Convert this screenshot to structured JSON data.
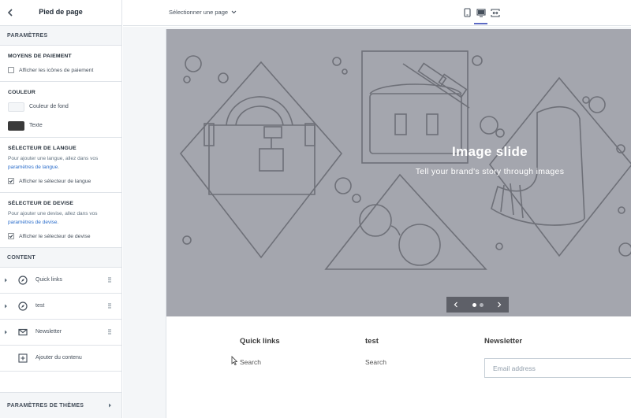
{
  "sidebar": {
    "title": "Pied de page",
    "settings_header": "PARAMÈTRES",
    "payment": {
      "title": "MOYENS DE PAIEMENT",
      "checkbox_label": "Afficher les icônes de paiement",
      "checked": false
    },
    "color": {
      "title": "COULEUR",
      "items": [
        {
          "label": "Couleur de fond",
          "swatch": "#f4f6f8"
        },
        {
          "label": "Texte",
          "swatch": "#3a3a3a"
        }
      ]
    },
    "language": {
      "title": "SÉLECTEUR DE LANGUE",
      "desc": "Pour ajouter une langue, allez dans vos",
      "link": "paramètres de langue",
      "desc_end": ".",
      "checkbox_label": "Afficher le sélecteur de langue",
      "checked": true
    },
    "currency": {
      "title": "SÉLECTEUR DE DEVISE",
      "desc": "Pour ajouter une devise, allez dans vos",
      "link": "paramètres de devise",
      "desc_end": ".",
      "checkbox_label": "Afficher le sélecteur de devise",
      "checked": true
    },
    "content_header": "CONTENT",
    "content_items": [
      {
        "label": "Quick links",
        "icon": "compass-icon"
      },
      {
        "label": "test",
        "icon": "compass-icon"
      },
      {
        "label": "Newsletter",
        "icon": "mail-icon"
      }
    ],
    "add_content": "Ajouter du contenu",
    "theme_settings": "PARAMÈTRES DE THÈMES"
  },
  "topbar": {
    "page_select": "Sélectionner une page",
    "devices": [
      "mobile-icon",
      "desktop-icon",
      "fullscreen-icon"
    ],
    "active_device": "desktop-icon"
  },
  "preview": {
    "hero": {
      "title": "Image slide",
      "subtitle": "Tell your brand's story through images",
      "active_slide": 1,
      "slide_count": 2
    },
    "footer": {
      "columns": [
        {
          "title": "Quick links",
          "link": "Search"
        },
        {
          "title": "test",
          "link": "Search"
        },
        {
          "title": "Newsletter",
          "placeholder": "Email address"
        }
      ]
    }
  },
  "colors": {
    "accent": "#5c6ac4",
    "hero_bg": "#a4a6ae",
    "link": "#2c6ecb"
  }
}
